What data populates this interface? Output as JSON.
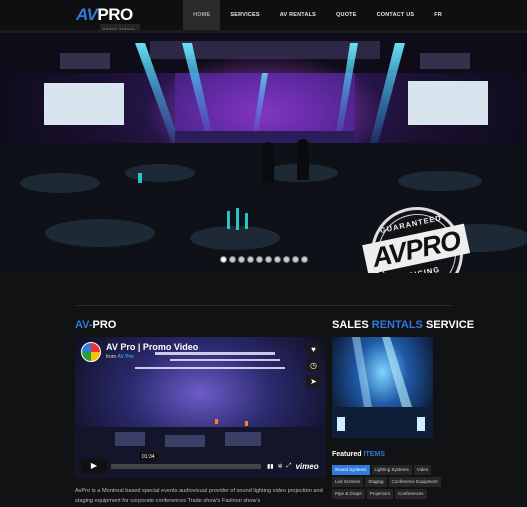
{
  "brand": {
    "logo_av": "AV",
    "logo_pro": "PRO",
    "tagline": "AUDIO VISUAL"
  },
  "nav": {
    "items": [
      {
        "label": "HOME",
        "active": true
      },
      {
        "label": "SERVICES",
        "active": false
      },
      {
        "label": "AV RENTALS",
        "active": false
      },
      {
        "label": "QUOTE",
        "active": false
      },
      {
        "label": "CONTACT US",
        "active": false
      },
      {
        "label": "FR",
        "active": false
      }
    ]
  },
  "hero": {
    "slide_count": 10,
    "active_slide": 1,
    "stamp": {
      "top": "GUARANTEED",
      "main": "AVPRO",
      "bottom": "PRICING"
    }
  },
  "left": {
    "heading_blue": "AV-",
    "heading_white": "PRO",
    "video": {
      "title": "AV Pro | Promo Video",
      "from_label": "from",
      "from_name": "AV Pro",
      "time": "01:34",
      "provider": "vimeo"
    },
    "description": "AvPro is a Montreal based special events audiovisual provider of sound lighting video projection and staging equipment for corporate conferences Trade show's Fashion show's"
  },
  "right": {
    "heading_1": "SALES",
    "heading_2": "RENTALS",
    "heading_3": "SERVICE",
    "featured_1": "Featured",
    "featured_2": "ITEMS",
    "tags": [
      {
        "label": "Sound Systems",
        "active": true
      },
      {
        "label": "Lighting Systems",
        "active": false
      },
      {
        "label": "Video",
        "active": false
      },
      {
        "label": "Led Screens",
        "active": false
      },
      {
        "label": "Staging",
        "active": false
      },
      {
        "label": "Conference Equipment",
        "active": false
      },
      {
        "label": "Pipe & Drape",
        "active": false
      },
      {
        "label": "Projectors",
        "active": false
      },
      {
        "label": "Conferences",
        "active": false
      }
    ]
  },
  "colors": {
    "accent": "#2f7bdc",
    "background": "#111214"
  }
}
